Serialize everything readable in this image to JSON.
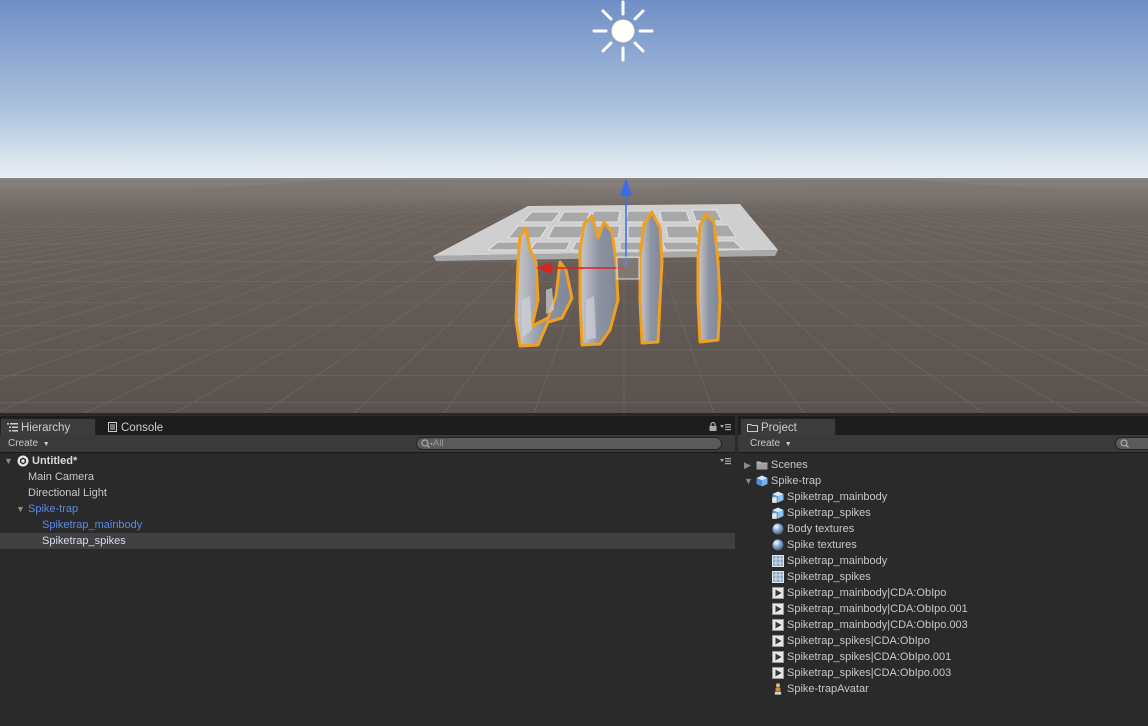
{
  "hierarchy": {
    "tabs": [
      {
        "label": "Hierarchy",
        "icon": "list-icon"
      },
      {
        "label": "Console",
        "icon": "console-icon"
      }
    ],
    "create_label": "Create",
    "search_placeholder": "All",
    "scene_name": "Untitled*",
    "items": [
      {
        "label": "Main Camera"
      },
      {
        "label": "Directional Light"
      },
      {
        "label": "Spike-trap",
        "state": "expanded",
        "style": "prefab"
      },
      {
        "label": "Spiketrap_mainbody",
        "style": "prefab"
      },
      {
        "label": "Spiketrap_spikes",
        "style": "prefab",
        "selected": true
      }
    ]
  },
  "project": {
    "tab_label": "Project",
    "create_label": "Create",
    "items": [
      {
        "label": "Scenes",
        "icon": "folder-icon",
        "state": "collapsed"
      },
      {
        "label": "Spike-trap",
        "icon": "model-prefab-icon",
        "state": "expanded"
      },
      {
        "label": "Spiketrap_mainbody",
        "icon": "mesh-prefab-icon"
      },
      {
        "label": "Spiketrap_spikes",
        "icon": "mesh-prefab-icon"
      },
      {
        "label": "Body textures",
        "icon": "material-sphere-icon"
      },
      {
        "label": "Spike textures",
        "icon": "material-sphere-icon"
      },
      {
        "label": "Spiketrap_mainbody",
        "icon": "mesh-grid-icon"
      },
      {
        "label": "Spiketrap_spikes",
        "icon": "mesh-grid-icon"
      },
      {
        "label": "Spiketrap_mainbody|CDA:ObIpo",
        "icon": "animation-clip-icon"
      },
      {
        "label": "Spiketrap_mainbody|CDA:ObIpo.001",
        "icon": "animation-clip-icon"
      },
      {
        "label": "Spiketrap_mainbody|CDA:ObIpo.003",
        "icon": "animation-clip-icon"
      },
      {
        "label": "Spiketrap_spikes|CDA:ObIpo",
        "icon": "animation-clip-icon"
      },
      {
        "label": "Spiketrap_spikes|CDA:ObIpo.001",
        "icon": "animation-clip-icon"
      },
      {
        "label": "Spiketrap_spikes|CDA:ObIpo.003",
        "icon": "animation-clip-icon"
      },
      {
        "label": "Spike-trapAvatar",
        "icon": "avatar-icon"
      }
    ]
  },
  "colors": {
    "sky_top": "#6f8fc6",
    "horizon": "#e6eef4",
    "ground": "#5f5753",
    "selection_outline": "#f0a020",
    "prefab_text": "#5a8ae6"
  }
}
